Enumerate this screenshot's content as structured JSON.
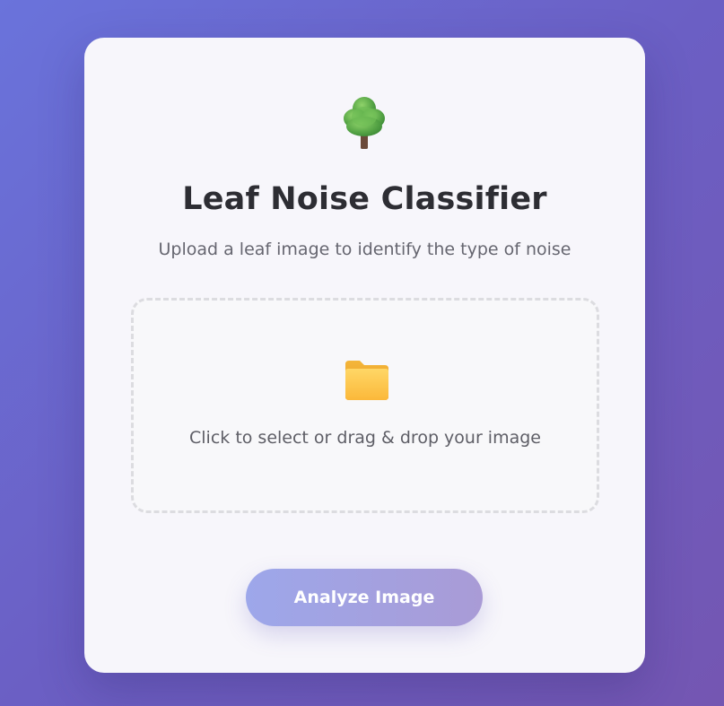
{
  "app": {
    "title": "Leaf Noise Classifier",
    "subtitle": "Upload a leaf image to identify the type of noise"
  },
  "icons": {
    "header": "tree-icon",
    "dropzone": "folder-icon"
  },
  "upload": {
    "prompt": "Click to select or drag & drop your image"
  },
  "actions": {
    "analyze_label": "Analyze Image"
  },
  "colors": {
    "background_start": "#6a73db",
    "background_end": "#7456b2",
    "card": "#f7f6fb",
    "title": "#2d2d33",
    "button_start": "#9da7ea",
    "button_end": "#a99bd6"
  }
}
